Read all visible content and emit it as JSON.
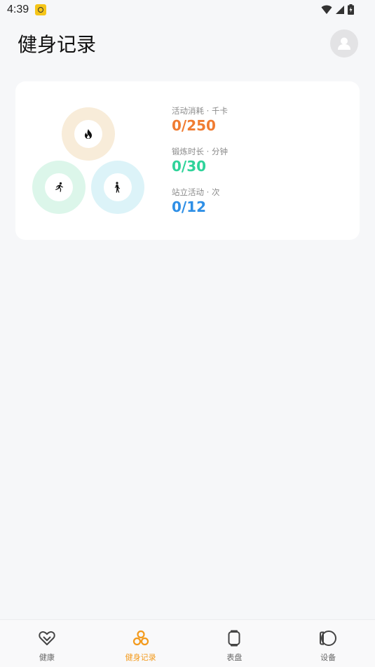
{
  "status_bar": {
    "time": "4:39"
  },
  "header": {
    "title": "健身记录"
  },
  "summary": {
    "stats": [
      {
        "label": "活动消耗 · 千卡",
        "value": "0/250",
        "color": "#f07c32"
      },
      {
        "label": "锻炼时长 · 分钟",
        "value": "0/30",
        "color": "#2fd39a"
      },
      {
        "label": "站立活动 · 次",
        "value": "0/12",
        "color": "#2e8fe6"
      }
    ],
    "rings": [
      {
        "name": "calories",
        "color": "#f8ecd9",
        "icon": "flame-icon"
      },
      {
        "name": "exercise",
        "color": "#dcf6ea",
        "icon": "running-icon"
      },
      {
        "name": "stand",
        "color": "#dcf3f8",
        "icon": "standing-icon"
      }
    ]
  },
  "bottom_nav": {
    "items": [
      {
        "label": "健康",
        "icon": "heart-icon",
        "active": false
      },
      {
        "label": "健身记录",
        "icon": "rings-icon",
        "active": true
      },
      {
        "label": "表盘",
        "icon": "watch-icon",
        "active": false
      },
      {
        "label": "设备",
        "icon": "device-icon",
        "active": false
      }
    ],
    "active_color": "#f39a1c"
  }
}
